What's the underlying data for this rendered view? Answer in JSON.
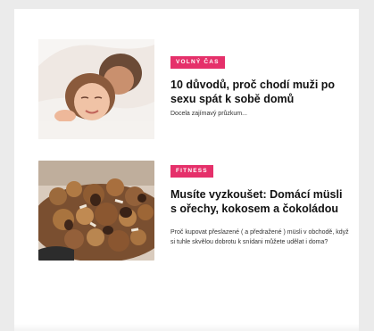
{
  "articles": [
    {
      "category": "VOLNÝ ČAS",
      "title": "10 důvodů, proč chodí muži po sexu spát k sobě domů",
      "excerpt": "Docela zajímavý průzkum...",
      "image": "couple-in-bed-photo"
    },
    {
      "category": "FITNESS",
      "title": "Musíte vyzkoušet: Domácí müsli s ořechy, kokosem a čokoládou",
      "excerpt": "Proč kupovat přeslazené ( a předražené ) müsli v obchodě, když si tuhle skvělou dobrotu k snídani můžete udělat i doma?",
      "image": "granola-with-nuts-photo"
    }
  ],
  "colors": {
    "badge": "#e5306a",
    "page_background": "#ebebeb",
    "card_background": "#ffffff"
  }
}
